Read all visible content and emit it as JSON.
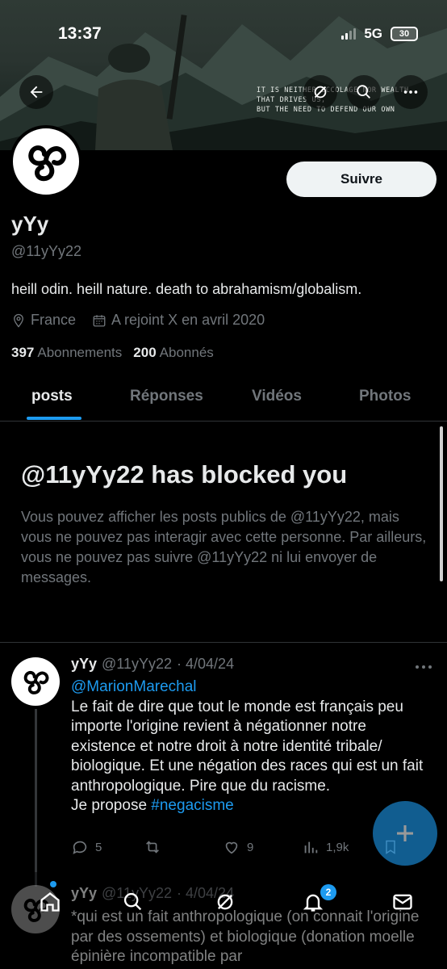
{
  "status": {
    "time": "13:37",
    "network": "5G",
    "battery": "30"
  },
  "banner": {
    "quote_lines": [
      "IT IS NEITHER ECCOLAGE NOR WEALTH",
      "THAT DRIVES US,",
      "BUT THE NEED TO DEFEND OUR OWN"
    ]
  },
  "header_icons": [
    "back-arrow-icon",
    "grok-icon",
    "search-icon",
    "more-icon"
  ],
  "profile": {
    "display_name": "yYy",
    "handle": "@11yYy22",
    "bio": "heill odin. heill nature. death to abrahamism/globalism.",
    "location": "France",
    "joined": "A rejoint X en avril 2020",
    "following_count": "397",
    "following_label": "Abonnements",
    "followers_count": "200",
    "followers_label": "Abonnés",
    "follow_label": "Suivre"
  },
  "tabs": [
    {
      "label": "posts",
      "active": true
    },
    {
      "label": "Réponses",
      "active": false
    },
    {
      "label": "Vidéos",
      "active": false
    },
    {
      "label": "Photos",
      "active": false
    }
  ],
  "blocked": {
    "title": "@11yYy22 has blocked you",
    "message": "Vous pouvez afficher les posts publics de @11yYy22, mais vous ne pouvez pas interagir avec cette personne. Par ailleurs, vous ne pouvez pas suivre @11yYy22 ni lui envoyer de messages."
  },
  "tweets": [
    {
      "name": "yYy",
      "handle": "@11yYy22",
      "date": "· 4/04/24",
      "mention": "@MarionMarechal",
      "text": "Le fait de dire que tout le monde est français peu importe l'origine revient à négationner notre existence et notre droit à notre identité tribale/ biologique. Et une négation des races qui est un fait anthropologique. Pire que du racisme.",
      "text_prefix": "Je propose ",
      "hashtag": "#negacisme",
      "replies": "5",
      "retweets": "",
      "likes": "9",
      "views": "1,9k"
    },
    {
      "name": "yYy",
      "handle": "@11yYy22",
      "date": "· 4/04/24",
      "text": "*qui est un fait anthropologique (on connait l'origine par des ossements) et biologique (donation moelle épinière incompatible par"
    }
  ],
  "nav": {
    "notifications_badge": "2"
  },
  "colors": {
    "accent": "#1d9bf0",
    "muted": "#71767b",
    "text": "#e7e9ea",
    "background": "#000000"
  }
}
